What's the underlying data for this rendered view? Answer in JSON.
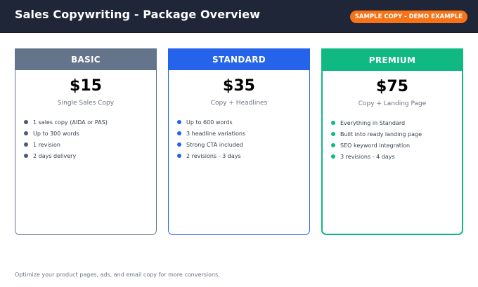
{
  "header": {
    "title": "Sales Copywriting - Package Overview",
    "badge": "SAMPLE COPY - DEMO EXAMPLE"
  },
  "colors": {
    "header_bg": "#1e2638",
    "badge": "#f97316",
    "basic": "#64748b",
    "standard": "#2563eb",
    "premium": "#10b981"
  },
  "packages": [
    {
      "name": "BASIC",
      "price": "$15",
      "subtitle": "Single Sales Copy",
      "features": [
        "1 sales copy (AIDA or PAS)",
        "Up to 300 words",
        "1 revision",
        "2 days delivery"
      ]
    },
    {
      "name": "STANDARD",
      "price": "$35",
      "subtitle": "Copy + Headlines",
      "features": [
        "Up to 600 words",
        "3 headline variations",
        "Strong CTA included",
        "2 revisions - 3 days"
      ]
    },
    {
      "name": "PREMIUM",
      "price": "$75",
      "subtitle": "Copy + Landing Page",
      "features": [
        "Everything in Standard",
        "Built into ready landing page",
        "SEO keyword integration",
        "3 revisions - 4 days"
      ]
    }
  ],
  "footer": {
    "text": "Optimize your product pages, ads, and email copy for more conversions."
  }
}
